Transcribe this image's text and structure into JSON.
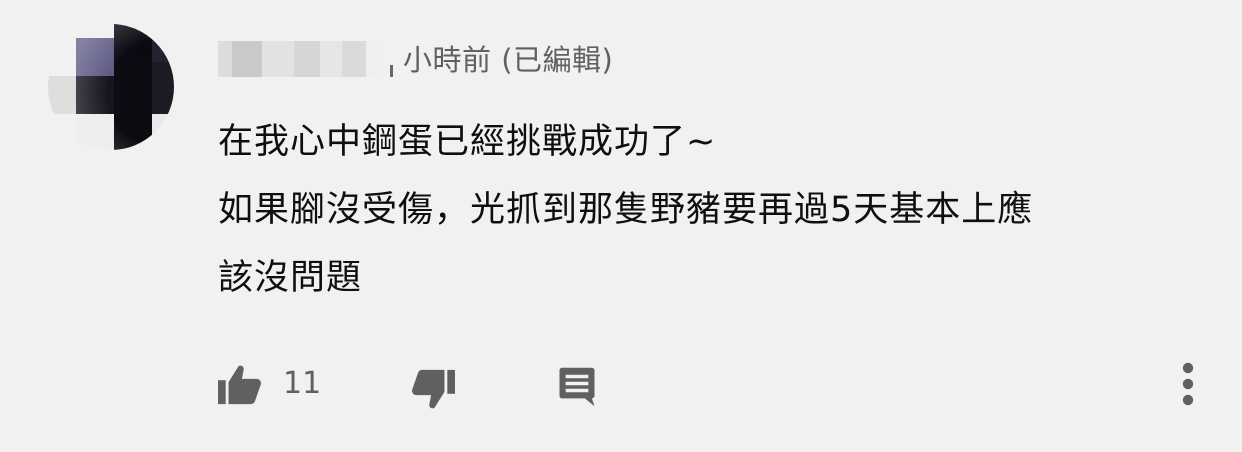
{
  "comment": {
    "author_name": "",
    "timestamp": "小時前 (已編輯)",
    "lines": [
      "在我心中鋼蛋已經挑戰成功了~",
      "如果腳沒受傷，光抓到那隻野豬要再過5天基本上應",
      "該沒問題"
    ],
    "like_count": "11"
  },
  "icons": {
    "like": "thumbs-up-icon",
    "dislike": "thumbs-down-icon",
    "reply": "reply-comment-icon",
    "more": "more-vert-icon"
  },
  "colors": {
    "background": "#f1f1f1",
    "text_primary": "#0f0f0f",
    "text_secondary": "#606060",
    "icon": "#606060"
  }
}
